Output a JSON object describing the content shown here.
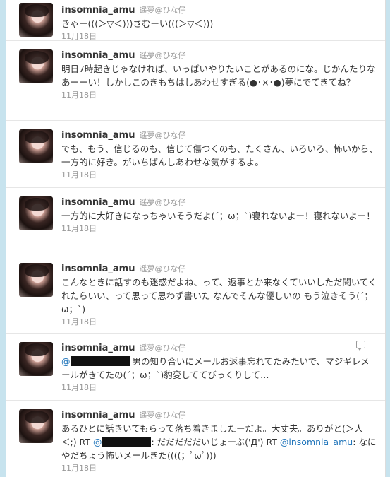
{
  "tweets": [
    {
      "screen_name": "insomnia_amu",
      "full_name": "遥夢@ひな仔",
      "text": "きゃー(((＞▽＜)))さむーい(((＞▽＜)))",
      "time": "11月18日"
    },
    {
      "screen_name": "insomnia_amu",
      "full_name": "遥夢@ひな仔",
      "text": "明日7時起きじゃなければ、いっぱいやりたいことがあるのにな。じかんたりなあーーい！しかしこのきもちはしあわせすぎる(●･×･●)夢にでてきてね？",
      "time": "11月18日"
    },
    {
      "screen_name": "insomnia_amu",
      "full_name": "遥夢@ひな仔",
      "text": "でも、もう、信じるのも、信じて傷つくのも、たくさん、いろいろ、怖いから、一方的に好き。がいちばんしあわせな気がするよ。",
      "time": "11月18日"
    },
    {
      "screen_name": "insomnia_amu",
      "full_name": "遥夢@ひな仔",
      "text": "一方的に大好きになっちゃいそうだよ(´；ω；`)寝れないよー！寝れないよー！",
      "time": "11月18日"
    },
    {
      "screen_name": "insomnia_amu",
      "full_name": "遥夢@ひな仔",
      "text": "こんなときに話すのも迷惑だよね、って、返事とか来なくていいしただ聞いてくれたらいい、って思って思わず書いた なんでそんな優しいの もう泣きそう(´；ω；`)",
      "time": "11月18日"
    },
    {
      "screen_name": "insomnia_amu",
      "full_name": "遥夢@ひな仔",
      "text_prefix": "@",
      "text_after_redact": " 男の知り合いにメールお返事忘れてたみたいで、マジギレメールがきてたの(´；ω；`)豹変しててびっくりして…",
      "time": "11月18日",
      "reply_icon": "reply-icon"
    },
    {
      "screen_name": "insomnia_amu",
      "full_name": "遥夢@ひな仔",
      "text_before": "あるひとに話きいてもらって落ち着きましたーだよ。大丈夫。ありがと(＞人＜;) RT ",
      "text_mention_start": "@",
      "text_after_redact": ": だだだだだいじょーぶ('Д') RT ",
      "mention": "@insomnia_amu",
      "text_end": ": なにやだちょう怖いメールきた((((；ﾟωﾟ)))",
      "time": "11月18日"
    }
  ]
}
